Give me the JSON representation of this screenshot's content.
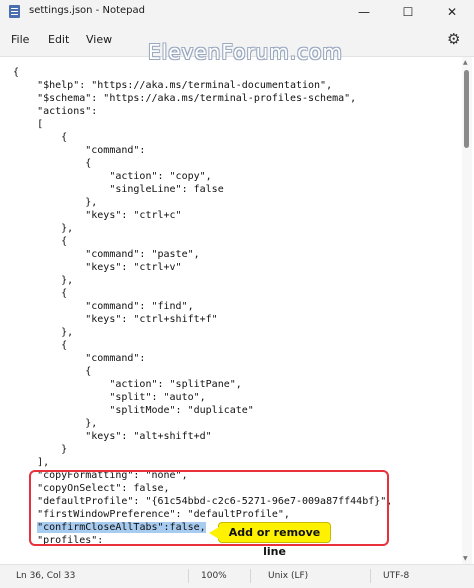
{
  "window": {
    "title": "settings.json - Notepad",
    "minimize": "—",
    "maximize": "☐",
    "close": "✕"
  },
  "menu": {
    "file": "File",
    "edit": "Edit",
    "view": "View"
  },
  "icons": {
    "settings": "gear-icon",
    "app": "notepad-icon"
  },
  "watermark": "ElevenForum.com",
  "code_lines": [
    "{",
    "    \"$help\": \"https://aka.ms/terminal-documentation\",",
    "    \"$schema\": \"https://aka.ms/terminal-profiles-schema\",",
    "    \"actions\":",
    "    [",
    "        {",
    "            \"command\":",
    "            {",
    "                \"action\": \"copy\",",
    "                \"singleLine\": false",
    "            },",
    "            \"keys\": \"ctrl+c\"",
    "        },",
    "        {",
    "            \"command\": \"paste\",",
    "            \"keys\": \"ctrl+v\"",
    "        },",
    "        {",
    "            \"command\": \"find\",",
    "            \"keys\": \"ctrl+shift+f\"",
    "        },",
    "        {",
    "            \"command\":",
    "            {",
    "                \"action\": \"splitPane\",",
    "                \"split\": \"auto\",",
    "                \"splitMode\": \"duplicate\"",
    "            },",
    "            \"keys\": \"alt+shift+d\"",
    "        }",
    "    ],",
    "    \"copyFormatting\": \"none\",",
    "    \"copyOnSelect\": false,",
    "    \"defaultProfile\": \"{61c54bbd-c2c6-5271-96e7-009a87ff44bf}\",",
    "    \"firstWindowPreference\": \"defaultProfile\",",
    "    \"profiles\":"
  ],
  "selected_line": {
    "indent": "    ",
    "text": "\"confirmCloseAllTabs\":false,"
  },
  "callout": "Add or remove line",
  "status": {
    "position": "Ln 36, Col 33",
    "zoom": "100%",
    "line_ending": "Unix (LF)",
    "encoding": "UTF-8"
  },
  "colors": {
    "selection": "#a8cbf0",
    "highlight_border": "#e8313c",
    "callout_bg": "#fff200"
  }
}
